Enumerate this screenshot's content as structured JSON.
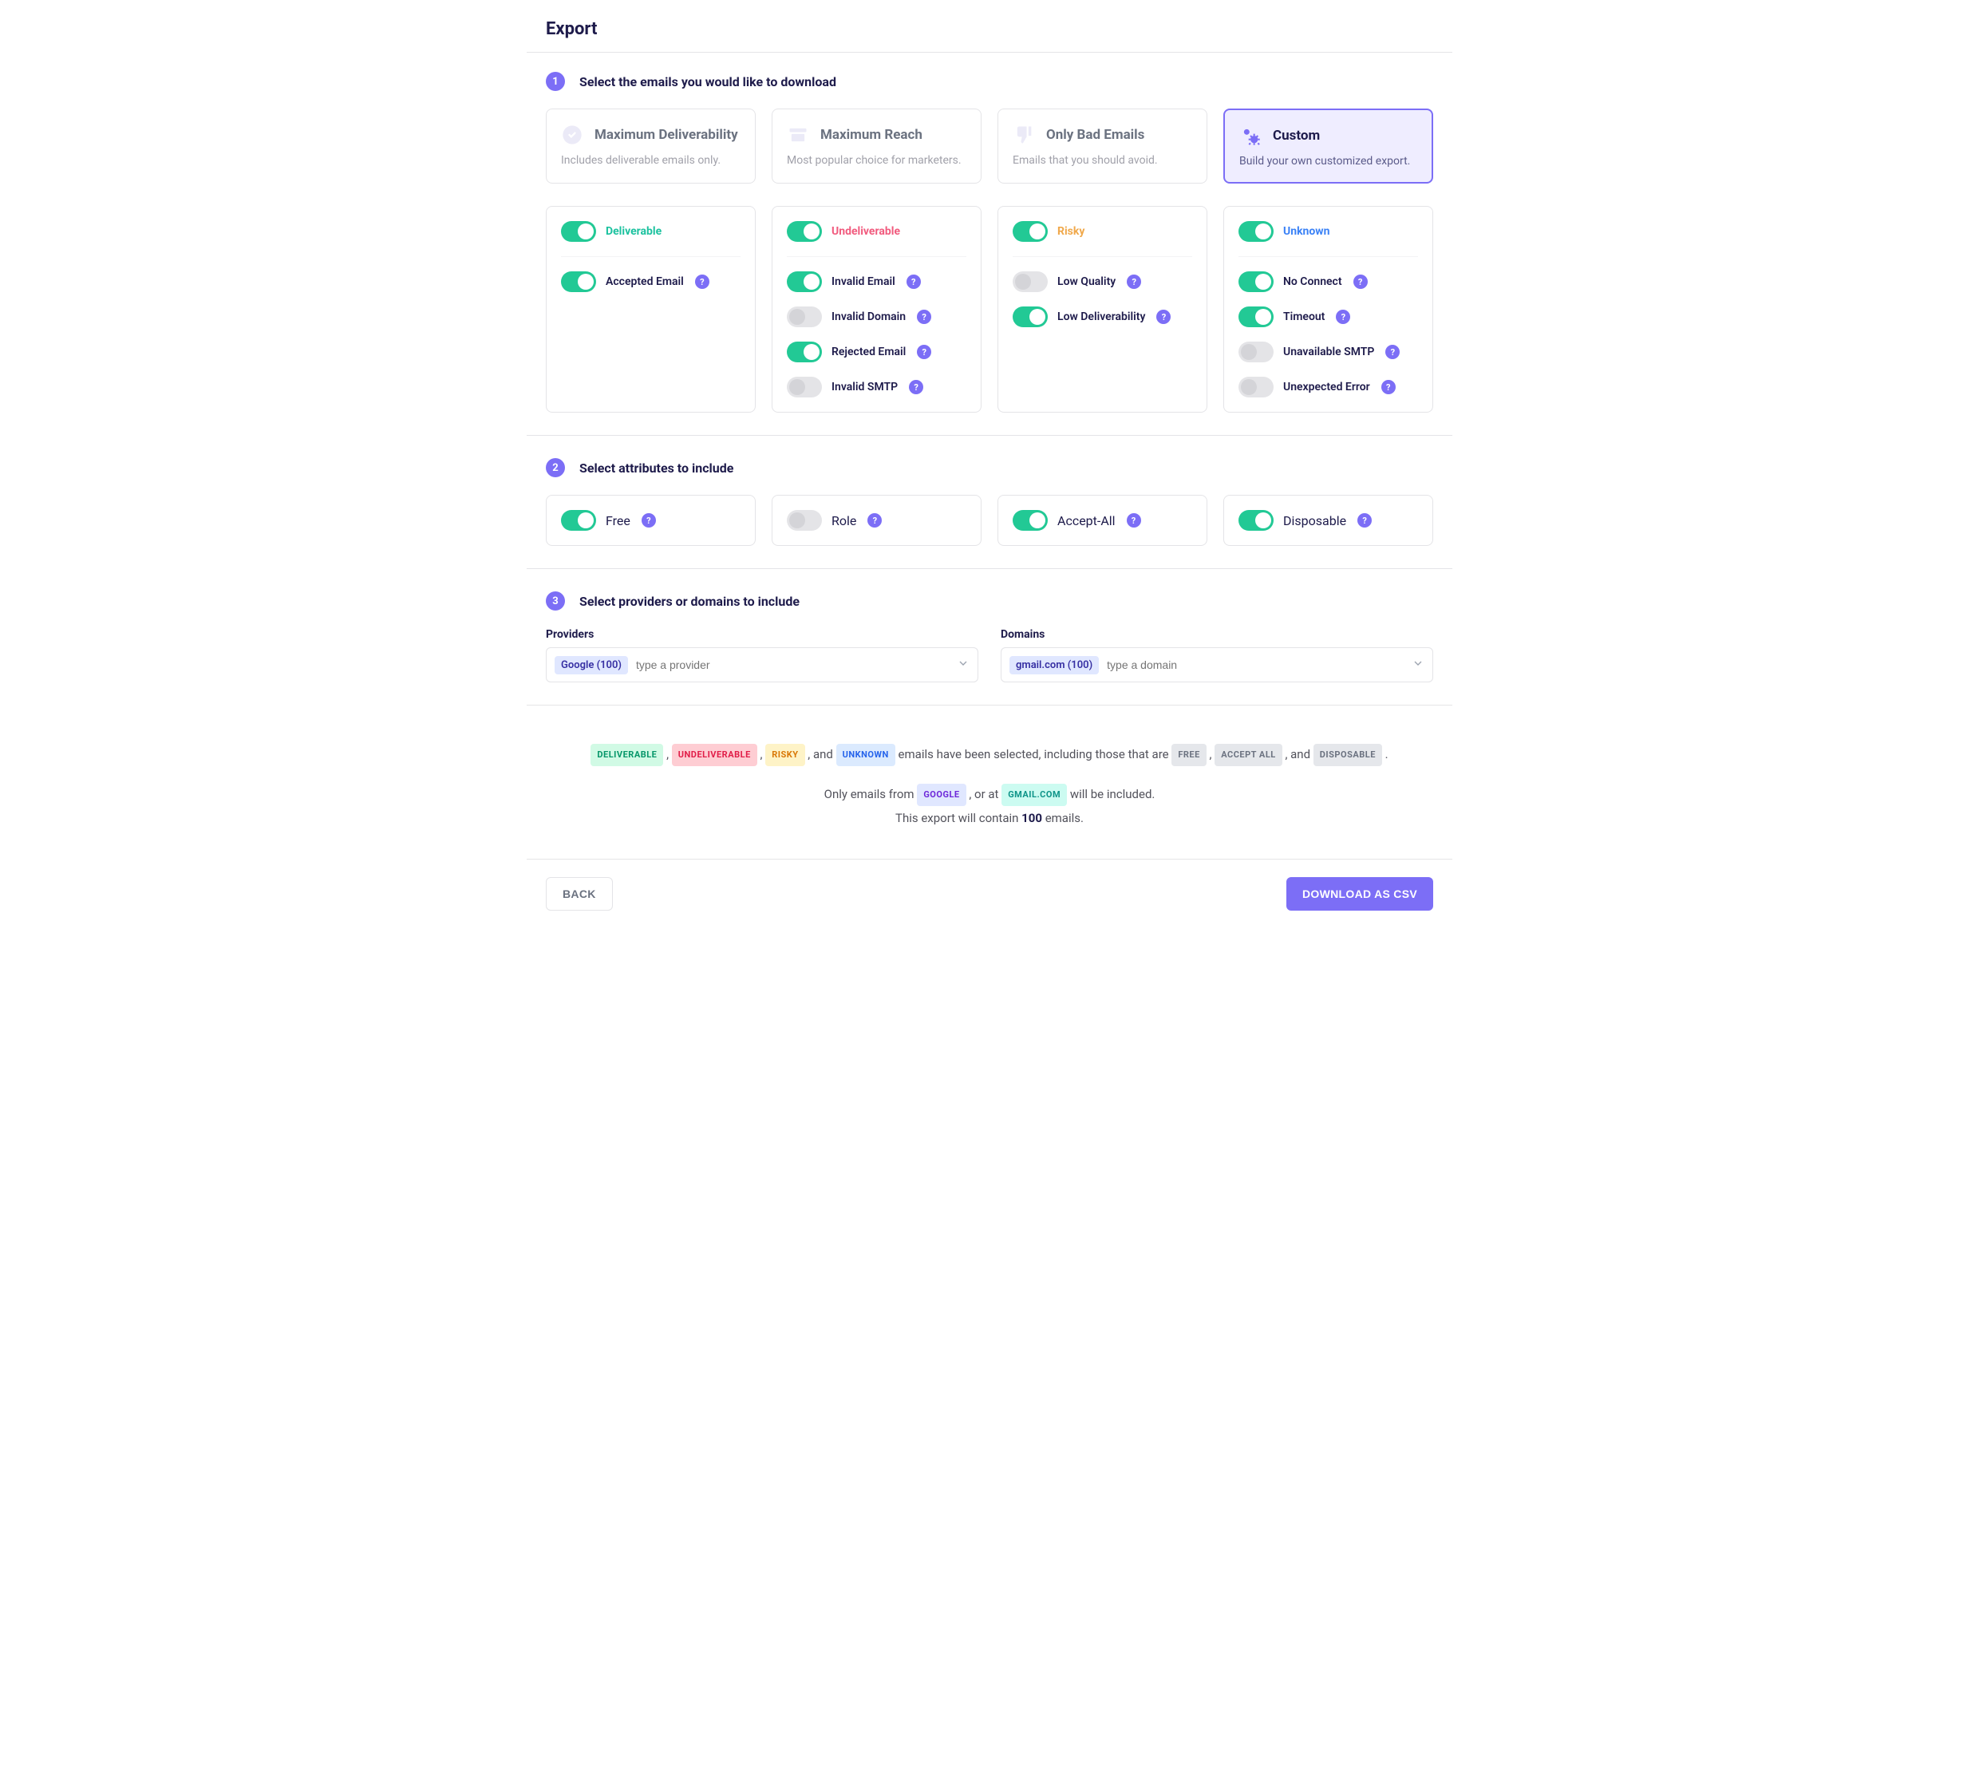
{
  "page_title": "Export",
  "steps": {
    "s1": {
      "num": "1",
      "title": "Select the emails you would like to download"
    },
    "s2": {
      "num": "2",
      "title": "Select attributes to include"
    },
    "s3": {
      "num": "3",
      "title": "Select providers or domains to include"
    }
  },
  "presets": {
    "max_deliv": {
      "title": "Maximum Deliverability",
      "desc": "Includes deliverable emails only."
    },
    "max_reach": {
      "title": "Maximum Reach",
      "desc": "Most popular choice for marketers."
    },
    "bad": {
      "title": "Only Bad Emails",
      "desc": "Emails that you should avoid."
    },
    "custom": {
      "title": "Custom",
      "desc": "Build your own customized export."
    }
  },
  "categories": {
    "deliverable": {
      "label": "Deliverable",
      "items": [
        {
          "label": "Accepted Email",
          "on": true
        }
      ]
    },
    "undeliverable": {
      "label": "Undeliverable",
      "items": [
        {
          "label": "Invalid Email",
          "on": true
        },
        {
          "label": "Invalid Domain",
          "on": false
        },
        {
          "label": "Rejected Email",
          "on": true
        },
        {
          "label": "Invalid SMTP",
          "on": false
        }
      ]
    },
    "risky": {
      "label": "Risky",
      "items": [
        {
          "label": "Low Quality",
          "on": false
        },
        {
          "label": "Low Deliverability",
          "on": true
        }
      ]
    },
    "unknown": {
      "label": "Unknown",
      "items": [
        {
          "label": "No Connect",
          "on": true
        },
        {
          "label": "Timeout",
          "on": true
        },
        {
          "label": "Unavailable SMTP",
          "on": false
        },
        {
          "label": "Unexpected Error",
          "on": false
        }
      ]
    }
  },
  "attributes": [
    {
      "label": "Free",
      "on": true
    },
    {
      "label": "Role",
      "on": false
    },
    {
      "label": "Accept-All",
      "on": true
    },
    {
      "label": "Disposable",
      "on": true
    }
  ],
  "providers": {
    "label": "Providers",
    "tag": "Google (100)",
    "placeholder": "type a provider"
  },
  "domains": {
    "label": "Domains",
    "tag": "gmail.com (100)",
    "placeholder": "type a domain"
  },
  "summary": {
    "pill_deliverable": "DELIVERABLE",
    "pill_undeliverable": "UNDELIVERABLE",
    "pill_risky": "RISKY",
    "pill_unknown": "UNKNOWN",
    "mid1": " emails have been selected, including those that are ",
    "pill_free": "FREE",
    "pill_accept_all": "ACCEPT ALL",
    "and": ", and ",
    "pill_disposable": "DISPOSABLE",
    "period": ".",
    "line2_a": "Only emails from ",
    "pill_google": "GOOGLE",
    "line2_b": ", or at ",
    "pill_gmail": "GMAIL.COM",
    "line2_c": " will be included.",
    "line3_a": "This export will contain ",
    "count": "100",
    "line3_b": " emails."
  },
  "footer": {
    "back": "BACK",
    "download": "DOWNLOAD AS CSV"
  },
  "help_label": "?"
}
